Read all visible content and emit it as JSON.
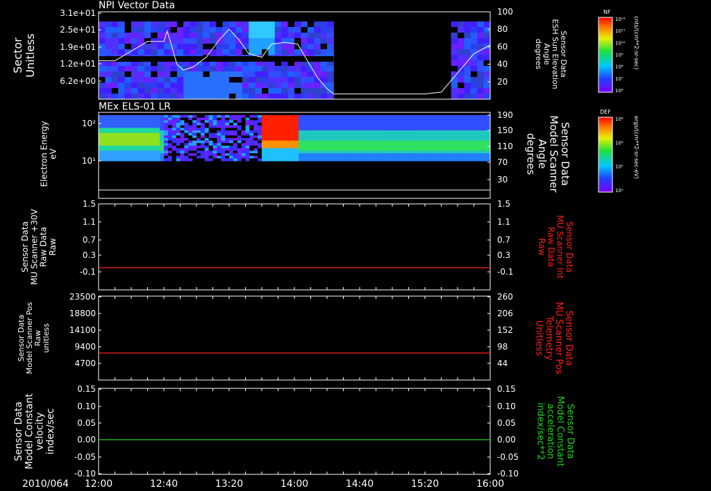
{
  "date_label": "2010/064",
  "time_ticks": [
    "12:00",
    "12:40",
    "13:20",
    "14:00",
    "14:40",
    "15:20",
    "16:00"
  ],
  "colors": {
    "red": "#ff2020",
    "green": "#20d020",
    "white": "#ffffff"
  },
  "chart_data": [
    {
      "type": "heatmap",
      "title": "NPI Vector Data",
      "ylabel": [
        "Sector",
        "Unitless"
      ],
      "yticks": [
        "3.1e+01",
        "2.5e+01",
        "1.9e+01",
        "1.2e+01",
        "6.2e+00"
      ],
      "ylabel_right": [
        "Sensor Data",
        "ESH Sun Elevation",
        "Angle",
        "degrees"
      ],
      "yticks_right": [
        "100",
        "80",
        "60",
        "40",
        "20"
      ],
      "ylim_right": [
        0,
        100
      ],
      "colorbar": {
        "label": "NF",
        "units": "cnts/(cm**2-sr-sec)",
        "ticks": [
          "10¹²",
          "10¹¹",
          "10¹⁰",
          "10⁹",
          "10⁸",
          "10⁷",
          "10⁶"
        ]
      },
      "overlay_line": {
        "name": "ESH Sun Elevation Angle",
        "x_minutes": [
          0,
          10,
          20,
          30,
          40,
          42,
          44,
          48,
          52,
          58,
          66,
          74,
          80,
          86,
          92,
          100,
          106,
          114,
          122,
          128,
          134,
          140,
          144,
          150,
          156,
          190,
          200,
          210,
          220,
          230,
          240
        ],
        "y_degrees": [
          44,
          44,
          55,
          66,
          66,
          78,
          66,
          40,
          33,
          37,
          48,
          68,
          80,
          68,
          52,
          48,
          63,
          65,
          63,
          44,
          25,
          12,
          6,
          6,
          6,
          6,
          6,
          8,
          30,
          52,
          62
        ]
      }
    },
    {
      "type": "heatmap",
      "title": "MEx ELS-01 LR",
      "ylabel": [
        "Electron Energy",
        "eV"
      ],
      "yticks": [
        "10²",
        "10¹"
      ],
      "ylabel_right": [
        "Sensor Data",
        "Model Scanner",
        "Angle",
        "degrees"
      ],
      "yticks_right": [
        "190",
        "150",
        "110",
        "70",
        "30"
      ],
      "ylim_right": [
        0,
        190
      ],
      "colorbar": {
        "label": "DEF",
        "units": "ergs/(cm**2-sr-sec-eV)",
        "ticks": [
          "10⁴",
          "10³",
          "10²",
          "10¹"
        ]
      },
      "overlay_line": {
        "name": "Model Scanner Angle",
        "constant": 5
      }
    },
    {
      "type": "line",
      "ylabel": [
        "Sensor Data",
        "MU Scanner +30V",
        "Raw Data",
        "Raw"
      ],
      "yticks": [
        "1.5",
        "1.1",
        "0.7",
        "0.3",
        "-0.1"
      ],
      "ylim": [
        -0.5,
        1.5
      ],
      "ylabel_right": [
        "Sensor Data",
        "MU Scanner Int",
        "Raw Data",
        "Raw"
      ],
      "yticks_right": [
        "1.5",
        "1.1",
        "0.7",
        "0.3",
        "-0.1"
      ],
      "series": [
        {
          "color": "red",
          "constant": 0.0
        }
      ]
    },
    {
      "type": "line",
      "ylabel": [
        "Sensor Data",
        "Model Scanner Pos",
        "Raw",
        "unitless"
      ],
      "yticks": [
        "23500",
        "18800",
        "14100",
        "9400",
        "4700"
      ],
      "ylim": [
        0,
        23500
      ],
      "ylabel_right": [
        "Sensor Data",
        "MU Scanner Pos",
        "Telemetry",
        "Unitless"
      ],
      "yticks_right": [
        "260",
        "206",
        "152",
        "98",
        "44"
      ],
      "series": [
        {
          "color": "red",
          "constant": 8200
        }
      ]
    },
    {
      "type": "line",
      "ylabel": [
        "Sensor Data",
        "Model Constant",
        "velocity",
        "index/sec"
      ],
      "yticks": [
        "0.15",
        "0.10",
        "0.05",
        "0.00",
        "-0.05",
        "-0.10"
      ],
      "ylim": [
        -0.1,
        0.15
      ],
      "ylabel_right": [
        "Sensor Data",
        "Model Constant",
        "acceleration",
        "index/sec**2"
      ],
      "yticks_right": [
        "0.15",
        "0.10",
        "0.05",
        "0.00",
        "-0.05",
        "-0.10"
      ],
      "series": [
        {
          "color": "green",
          "constant": 0.0
        }
      ]
    }
  ]
}
